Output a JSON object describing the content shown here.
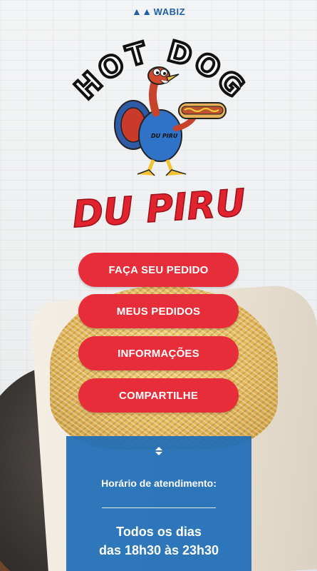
{
  "header": {
    "brand_label": "WABIZ"
  },
  "logo": {
    "top_text": "HOT DOG",
    "shirt_text": "DU PIRU",
    "bottom_text": "DU PIRU"
  },
  "menu": {
    "order_label": "FAÇA SEU PEDIDO",
    "my_orders_label": "MEUS PEDIDOS",
    "info_label": "INFORMAÇÕES",
    "share_label": "COMPARTILHE"
  },
  "hours": {
    "label": "Horário de atendimento:",
    "days": "Todos os dias",
    "time": "das 18h30 às 23h30"
  },
  "colors": {
    "primary_red": "#e72d3a",
    "panel_blue": "#1f6eb8",
    "brand_blue": "#1d5fa8"
  },
  "icons": {
    "brand": "wabiz-logo-icon",
    "expand": "expand-arrows-icon"
  }
}
